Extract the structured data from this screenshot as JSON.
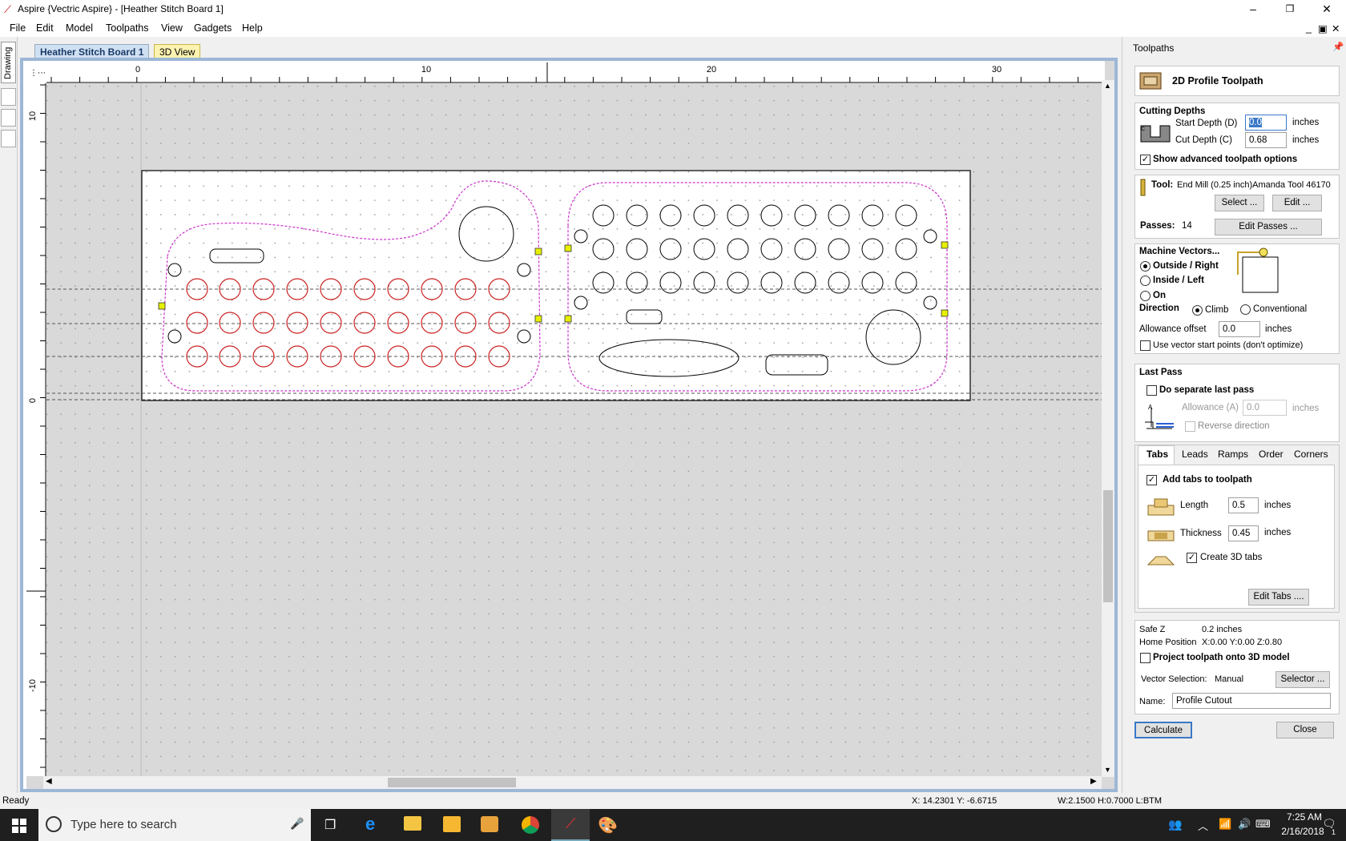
{
  "window": {
    "title": "Aspire {Vectric Aspire} - [Heather Stitch Board 1]"
  },
  "menu": [
    "File",
    "Edit",
    "Model",
    "Toolpaths",
    "View",
    "Gadgets",
    "Help"
  ],
  "left_strip": {
    "drawing_label": "Drawing"
  },
  "tabs": {
    "doc": "Heather Stitch Board 1",
    "view3d": "3D View"
  },
  "ruler": {
    "top": [
      "0",
      "10",
      "20",
      "30"
    ],
    "left": [
      "10",
      "0",
      "-10"
    ]
  },
  "status": {
    "left": "Ready",
    "coords": "X: 14.2301 Y: -6.6715",
    "size": "W:2.1500   H:0.7000  L:BTM"
  },
  "taskbar": {
    "search_placeholder": "Type here to search",
    "time": "7:25 AM",
    "date": "2/16/2018",
    "notify_count": "1"
  },
  "panel": {
    "title": "Toolpaths",
    "header": "2D Profile Toolpath",
    "cutting_depths": {
      "heading": "Cutting Depths",
      "start_label": "Start Depth (D)",
      "start_value": "0.0",
      "start_unit": "inches",
      "cut_label": "Cut Depth (C)",
      "cut_value": "0.68",
      "cut_unit": "inches",
      "advanced_label": "Show advanced toolpath options",
      "advanced_checked": true
    },
    "tool": {
      "label": "Tool:",
      "name": "End Mill (0.25 inch)Amanda Tool 46170",
      "select_btn": "Select ...",
      "edit_btn": "Edit ...",
      "passes_label": "Passes:",
      "passes_value": "14",
      "edit_passes_btn": "Edit Passes ..."
    },
    "machine_vectors": {
      "heading": "Machine Vectors...",
      "options": [
        "Outside / Right",
        "Inside / Left",
        "On"
      ],
      "selected": "Outside / Right",
      "direction_label": "Direction",
      "climb": "Climb",
      "conventional": "Conventional",
      "direction_selected": "Climb",
      "allowance_label": "Allowance offset",
      "allowance_value": "0.0",
      "allowance_unit": "inches",
      "start_points_label": "Use vector start points (don't optimize)",
      "start_points_checked": false
    },
    "last_pass": {
      "heading": "Last Pass",
      "separate_label": "Do separate last pass",
      "separate_checked": false,
      "allowance_label": "Allowance (A)",
      "allowance_value": "0.0",
      "allowance_unit": "inches",
      "reverse_label": "Reverse direction"
    },
    "subtabs": [
      "Tabs",
      "Leads",
      "Ramps",
      "Order",
      "Corners"
    ],
    "active_subtab": "Tabs",
    "tabs_section": {
      "add_label": "Add tabs to toolpath",
      "add_checked": true,
      "length_label": "Length",
      "length_value": "0.5",
      "length_unit": "inches",
      "thickness_label": "Thickness",
      "thickness_value": "0.45",
      "thickness_unit": "inches",
      "create3d_label": "Create 3D tabs",
      "create3d_checked": true,
      "edit_btn": "Edit Tabs ...."
    },
    "footer": {
      "safez_label": "Safe Z",
      "safez_value": "0.2 inches",
      "home_label": "Home Position",
      "home_value": "X:0.00 Y:0.00 Z:0.80",
      "project_label": "Project toolpath onto 3D model",
      "project_checked": false,
      "vector_sel_label": "Vector Selection:",
      "vector_sel_value": "Manual",
      "selector_btn": "Selector ...",
      "name_label": "Name:",
      "name_value": "Profile Cutout",
      "calculate_btn": "Calculate",
      "close_btn": "Close"
    }
  },
  "colors": {
    "accent_frame": "#9db7d6",
    "toolpath": "#cc33cc",
    "red_circles": "#cc2222",
    "tab_marker": "#e6f000"
  }
}
